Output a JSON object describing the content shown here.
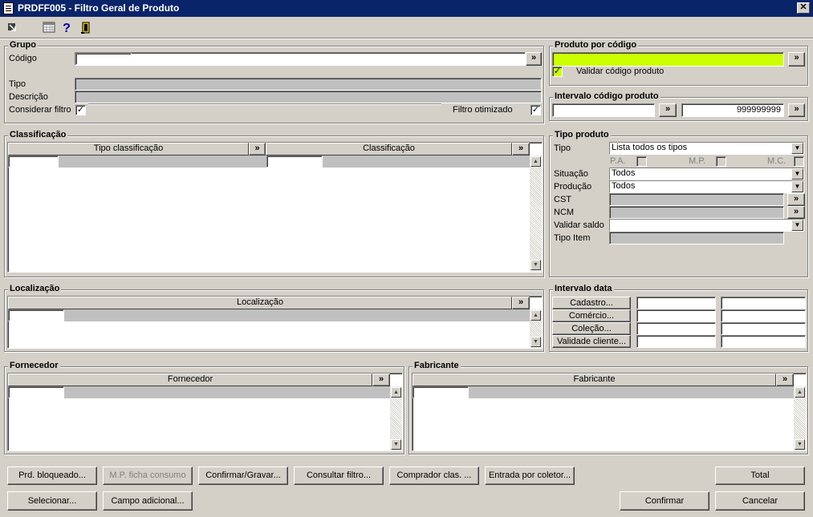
{
  "window": {
    "title": "PRDFF005 - Filtro Geral de Produto",
    "close": "✕"
  },
  "toolbar": {
    "icons": [
      "export-icon",
      "calendar-icon",
      "help-icon",
      "exit-icon"
    ]
  },
  "grupo": {
    "title": "Grupo",
    "codigo_label": "Código",
    "tipo_label": "Tipo",
    "descricao_label": "Descrição",
    "considerar_filtro_label": "Considerar filtro",
    "considerar_filtro_checked": "✓",
    "filtro_otimizado_label": "Filtro otimizado",
    "filtro_otimizado_checked": "✓",
    "lookup": "»"
  },
  "produto_codigo": {
    "title": "Produto por código",
    "value": "",
    "lookup": "»",
    "validar_label": "Validar código produto",
    "validar_checked": "✓"
  },
  "intervalo_codigo": {
    "title": "Intervalo código produto",
    "from": "",
    "to": "999999999",
    "lookup": "»"
  },
  "classificacao": {
    "title": "Classificação",
    "col1": "Tipo classificação",
    "col2": "Classificação",
    "lookup": "»"
  },
  "tipo_produto": {
    "title": "Tipo produto",
    "tipo_label": "Tipo",
    "tipo_value": "Lista todos os tipos",
    "pa": "P.A.",
    "mp": "M.P.",
    "mc": "M.C.",
    "situacao_label": "Situação",
    "situacao_value": "Todos",
    "producao_label": "Produção",
    "producao_value": "Todos",
    "cst_label": "CST",
    "ncm_label": "NCM",
    "validar_saldo_label": "Validar saldo",
    "validar_saldo_value": "",
    "tipo_item_label": "Tipo Item",
    "lookup": "»",
    "dropdown": "▼"
  },
  "localizacao": {
    "title": "Localização",
    "col": "Localização",
    "lookup": "»"
  },
  "intervalo_data": {
    "title": "Intervalo data",
    "buttons": [
      "Cadastro...",
      "Comércio...",
      "Coleção...",
      "Validade cliente..."
    ]
  },
  "fornecedor": {
    "title": "Fornecedor",
    "col": "Fornecedor",
    "lookup": "»"
  },
  "fabricante": {
    "title": "Fabricante",
    "col": "Fabricante",
    "lookup": "»"
  },
  "scroll": {
    "up": "▲",
    "down": "▼"
  },
  "buttons": {
    "prd_bloqueado": "Prd. bloqueado...",
    "mp_ficha": "M.P. ficha consumo",
    "confirmar_gravar": "Confirmar/Gravar...",
    "consultar_filtro": "Consultar filtro...",
    "comprador_clas": "Comprador clas. ...",
    "entrada_coletor": "Entrada por coletor...",
    "total": "Total",
    "selecionar": "Selecionar...",
    "campo_adicional": "Campo adicional...",
    "confirmar": "Confirmar",
    "cancelar": "Cancelar"
  }
}
